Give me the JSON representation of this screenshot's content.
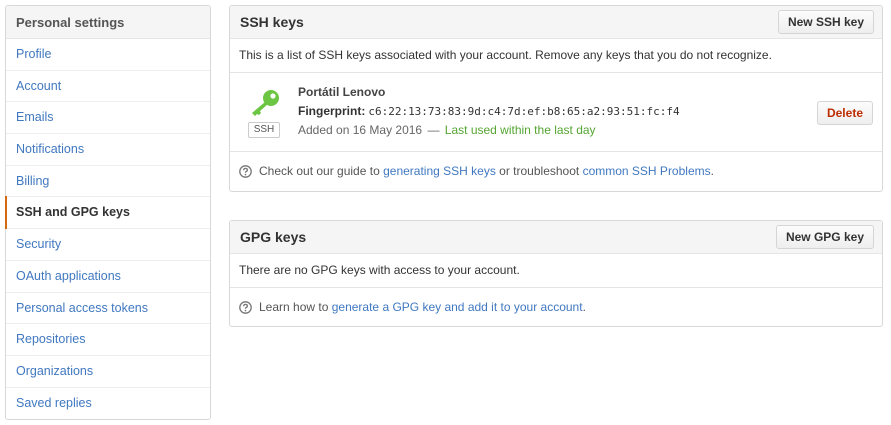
{
  "sidebar": {
    "title": "Personal settings",
    "items": [
      {
        "label": "Profile"
      },
      {
        "label": "Account"
      },
      {
        "label": "Emails"
      },
      {
        "label": "Notifications"
      },
      {
        "label": "Billing"
      },
      {
        "label": "SSH and GPG keys",
        "selected": true
      },
      {
        "label": "Security"
      },
      {
        "label": "OAuth applications"
      },
      {
        "label": "Personal access tokens"
      },
      {
        "label": "Repositories"
      },
      {
        "label": "Organizations"
      },
      {
        "label": "Saved replies"
      }
    ]
  },
  "ssh": {
    "title": "SSH keys",
    "new_button": "New SSH key",
    "intro": "This is a list of SSH keys associated with your account. Remove any keys that you do not recognize.",
    "key": {
      "title": "Portátil Lenovo",
      "type_badge": "SSH",
      "fingerprint_label": "Fingerprint:",
      "fingerprint": "c6:22:13:73:83:9d:c4:7d:ef:b8:65:a2:93:51:fc:f4",
      "added": "Added on 16 May 2016",
      "separator": "—",
      "last_used": "Last used within the last day",
      "delete_button": "Delete",
      "icon": "key-icon",
      "icon_color": "#6cc644"
    },
    "help": {
      "prefix": "Check out our guide to",
      "link1": "generating SSH keys",
      "middle": "or troubleshoot",
      "link2": "common SSH Problems",
      "suffix": "."
    }
  },
  "gpg": {
    "title": "GPG keys",
    "new_button": "New GPG key",
    "empty": "There are no GPG keys with access to your account.",
    "help": {
      "prefix": "Learn how to",
      "link": "generate a GPG key and add it to your account",
      "suffix": "."
    }
  },
  "colors": {
    "link": "#4078c0",
    "selected_marker": "#d26911",
    "last_used": "#55a532",
    "delete": "#bd2c00"
  }
}
